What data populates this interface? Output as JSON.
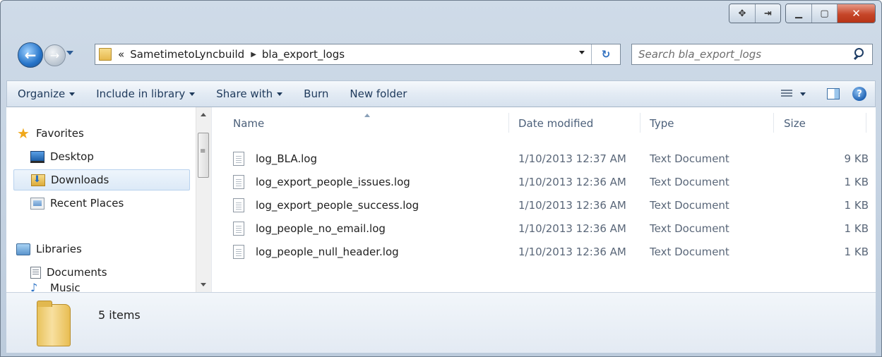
{
  "window": {
    "caption_buttons": [
      "move-icon",
      "snap-icon",
      "minimize",
      "maximize",
      "close"
    ]
  },
  "navigation": {
    "address_chevron": "«",
    "path": [
      "SametimetoLyncbuild",
      "bla_export_logs"
    ],
    "separator": "▶",
    "search_placeholder": "Search bla_export_logs"
  },
  "toolbar": {
    "organize": "Organize",
    "include_in_library": "Include in library",
    "share_with": "Share with",
    "burn": "Burn",
    "new_folder": "New folder"
  },
  "nav_pane": {
    "items": [
      {
        "label": "Favorites",
        "icon": "star-icon"
      },
      {
        "label": "Desktop",
        "icon": "desktop-icon"
      },
      {
        "label": "Downloads",
        "icon": "downloads-icon",
        "selected": true
      },
      {
        "label": "Recent Places",
        "icon": "recent-places-icon"
      },
      {
        "label": "Libraries",
        "icon": "libraries-icon"
      },
      {
        "label": "Documents",
        "icon": "documents-icon"
      },
      {
        "label": "Music",
        "icon": "music-icon"
      }
    ]
  },
  "file_list": {
    "columns": {
      "name": "Name",
      "date": "Date modified",
      "type": "Type",
      "size": "Size"
    },
    "sorted_by": "Name",
    "rows": [
      {
        "name": "log_BLA.log",
        "date": "1/10/2013 12:37 AM",
        "type": "Text Document",
        "size": "9 KB"
      },
      {
        "name": "log_export_people_issues.log",
        "date": "1/10/2013 12:36 AM",
        "type": "Text Document",
        "size": "1 KB"
      },
      {
        "name": "log_export_people_success.log",
        "date": "1/10/2013 12:36 AM",
        "type": "Text Document",
        "size": "1 KB"
      },
      {
        "name": "log_people_no_email.log",
        "date": "1/10/2013 12:36 AM",
        "type": "Text Document",
        "size": "1 KB"
      },
      {
        "name": "log_people_null_header.log",
        "date": "1/10/2013 12:36 AM",
        "type": "Text Document",
        "size": "1 KB"
      }
    ]
  },
  "details_pane": {
    "item_count": "5 items"
  },
  "colors": {
    "frame": "#bccbdc",
    "close_button": "#c64629",
    "selection": "#dce9f7"
  }
}
